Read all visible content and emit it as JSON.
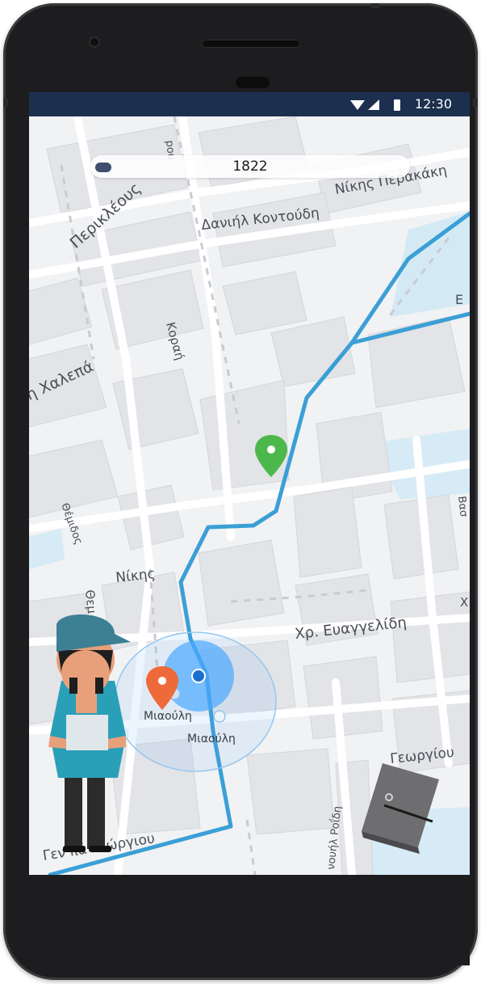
{
  "status_bar": {
    "time": "12:30",
    "icons": [
      "wifi-icon",
      "cell-signal-icon",
      "battery-icon"
    ]
  },
  "search": {
    "value": "1822"
  },
  "map": {
    "streets": {
      "perikleous": "Περικλέους",
      "daniil_kontoudi": "Δανιήλ Κοντούδη",
      "nikis_perakaki": "Νίκης Περακάκη",
      "korai": "Κοραή",
      "chalepa": "λη Χαλεπά",
      "themidos": "Θέμιδος",
      "nikis": "Νίκης",
      "them": "Θεμ",
      "chr_evangelidi": "Χρ. Ευαγγελίδη",
      "miaouli_1": "Μιαούλη",
      "miaouli_2": "Μιαούλη",
      "georgiou": "Γεωργίου",
      "vas_georgiou": "Γεν  πά Γεώργιου",
      "rosidi": "νουήλ Ροΐδη",
      "partial_pou": "pou",
      "partial_e": "Ε",
      "partial_bas": "Βασ",
      "partial_x": "Χ"
    },
    "route_color": "#3b9fd6",
    "accuracy_color": "#4aa8ff",
    "markers": {
      "destination": "green-pin-icon",
      "poi": "orange-pin-icon",
      "location": "blue-location-dot-icon"
    }
  },
  "colors": {
    "status_bar": "#1c2f4f",
    "map_background": "#f2f3f5",
    "building": "#e4e5e8",
    "water": "#d3eaf4",
    "green_pin": "#4cb84c",
    "orange_pin": "#ef6a3a"
  }
}
